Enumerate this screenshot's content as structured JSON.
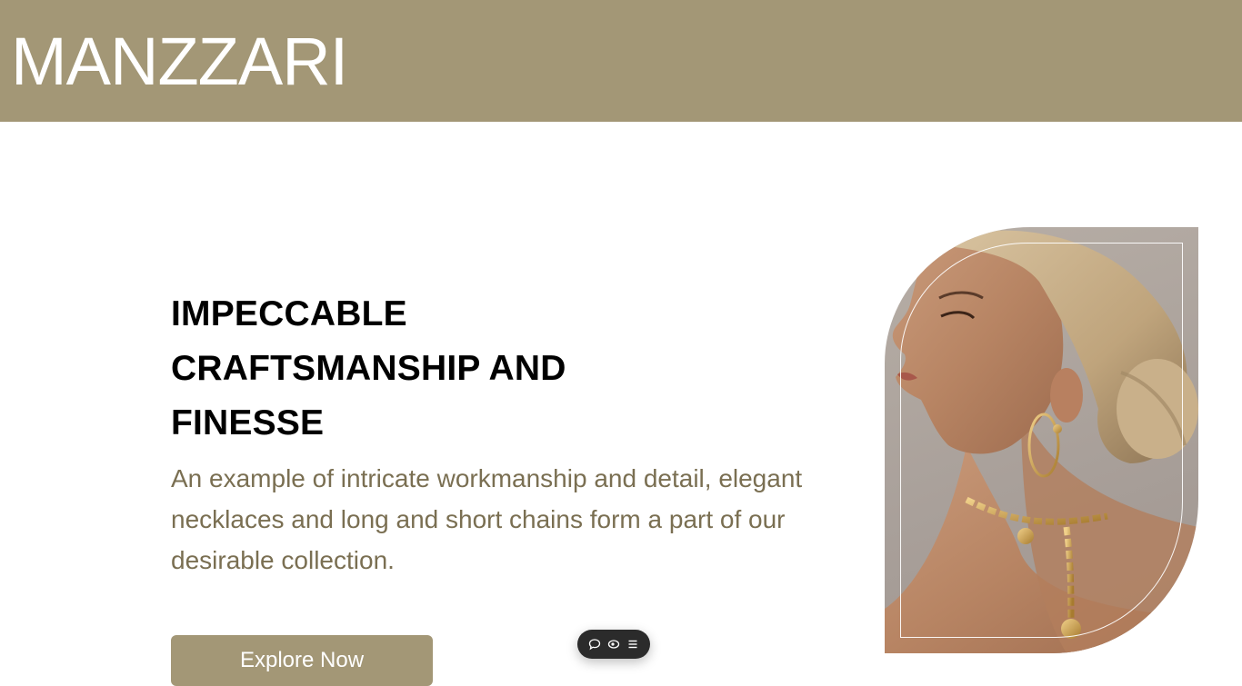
{
  "header": {
    "brand": "MANZZARI",
    "background_color": "#a39776"
  },
  "hero": {
    "title_lines": [
      "IMPECCABLE",
      "CRAFTSMANSHIP AND",
      "FINESSE"
    ],
    "description": "An example of intricate workmanship and detail, elegant necklaces and long and short chains form a part of our desirable collection.",
    "description_color": "#7a6f52",
    "cta_label": "Explore Now",
    "image_subject": "model-profile-with-gold-jewelry"
  },
  "floating_toolbar": {
    "icons": [
      "comment-icon",
      "eye-icon",
      "menu-icon"
    ]
  }
}
